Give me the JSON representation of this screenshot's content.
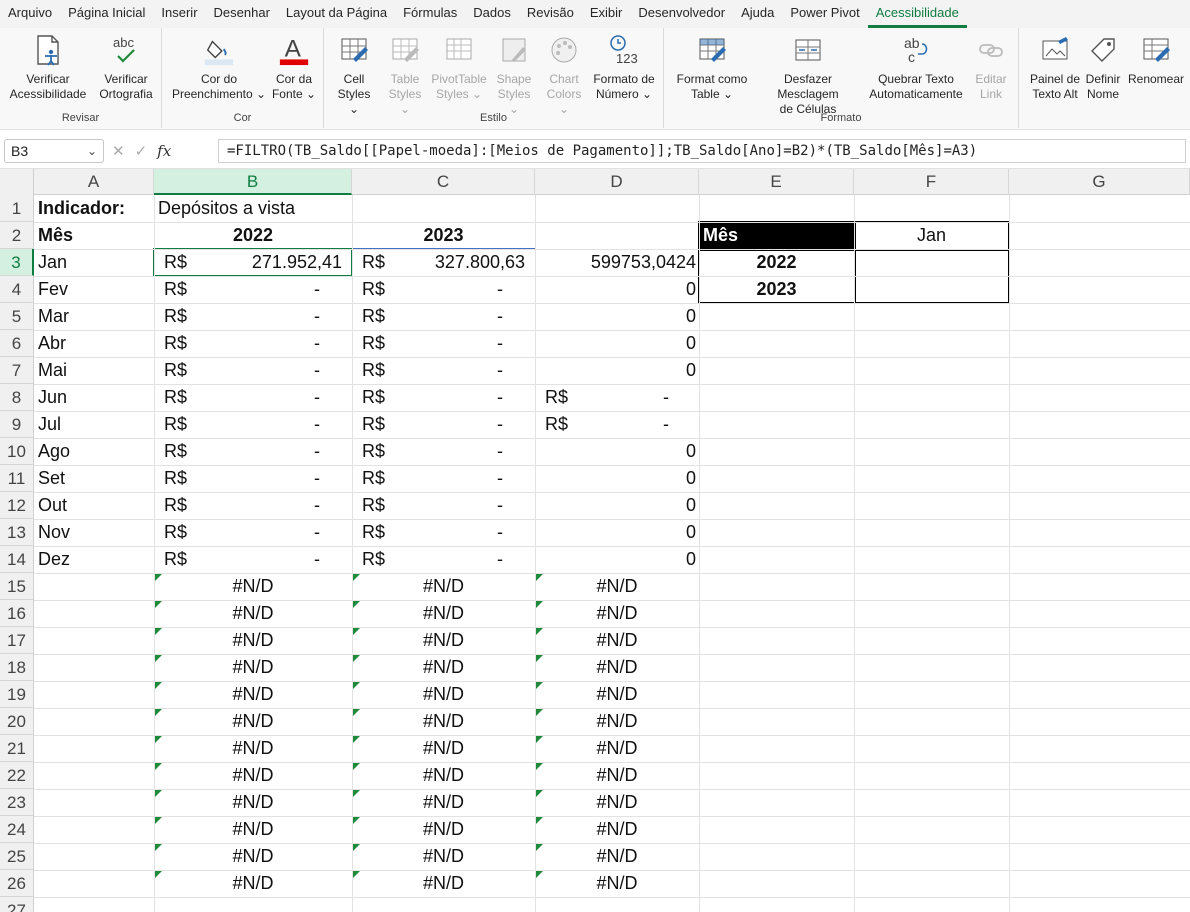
{
  "menu": {
    "tabs": [
      "Arquivo",
      "Página Inicial",
      "Inserir",
      "Desenhar",
      "Layout da Página",
      "Fórmulas",
      "Dados",
      "Revisão",
      "Exibir",
      "Desenvolvedor",
      "Ajuda",
      "Power Pivot",
      "Acessibilidade"
    ],
    "active_tab": "Acessibilidade"
  },
  "ribbon": {
    "groups": {
      "revisar": "Revisar",
      "cor": "Cor",
      "estilo": "Estilo",
      "formato": "Formato"
    },
    "buttons": {
      "verificar_acessibilidade": "Verificar\nAcessibilidade",
      "verificar_ortografia": "Verificar\nOrtografia",
      "cor_preenchimento": "Cor do\nPreenchimento ⌄",
      "cor_fonte": "Cor da\nFonte ⌄",
      "cell_styles": "Cell\nStyles ⌄",
      "table_styles": "Table\nStyles ⌄",
      "pivottable_styles": "PivotTable\nStyles ⌄",
      "shape_styles": "Shape\nStyles ⌄",
      "chart_colors": "Chart\nColors ⌄",
      "formato_numero": "Formato de\nNúmero ⌄",
      "format_como_table": "Format como\nTable ⌄",
      "desfazer_mesclagem": "Desfazer Mesclagem\nde Células",
      "quebrar_texto": "Quebrar Texto\nAutomaticamente",
      "editar_link": "Editar\nLink",
      "painel_texto_alt": "Painel de\nTexto Alt",
      "definir_nome": "Definir\nNome",
      "renomear": "Renomear"
    },
    "icon_text": {
      "abc": "abc",
      "ab": "ab",
      "c": "c",
      "num": "123",
      "letter_a": "A"
    }
  },
  "formula_bar": {
    "name_box": "B3",
    "name_box_caret": "⌄",
    "cancel": "✕",
    "enter": "✓",
    "fx": "fx",
    "formula": "=FILTRO(TB_Saldo[[Papel-moeda]:[Meios de Pagamento]];TB_Saldo[Ano]=B2)*(TB_Saldo[Mês]=A3)"
  },
  "columns": [
    "A",
    "B",
    "C",
    "D",
    "E",
    "F",
    "G"
  ],
  "rows": [
    "1",
    "2",
    "3",
    "4",
    "5",
    "6",
    "7",
    "8",
    "9",
    "10",
    "11",
    "12",
    "13",
    "14",
    "15",
    "16",
    "17",
    "18",
    "19",
    "20",
    "21",
    "22",
    "23",
    "24",
    "25",
    "26",
    "27"
  ],
  "sheet": {
    "a1": "Indicador:",
    "b1": "Depósitos a vista",
    "a2": "Mês",
    "b2": "2022",
    "c2": "2023",
    "months": [
      "Jan",
      "Fev",
      "Mar",
      "Abr",
      "Mai",
      "Jun",
      "Jul",
      "Ago",
      "Set",
      "Out",
      "Nov",
      "Dez"
    ],
    "currency": "R$",
    "dash": "-",
    "b_values": [
      "271.952,41",
      "-",
      "-",
      "-",
      "-",
      "-",
      "-",
      "-",
      "-",
      "-",
      "-",
      "-"
    ],
    "c_values": [
      "327.800,63",
      "-",
      "-",
      "-",
      "-",
      "-",
      "-",
      "-",
      "-",
      "-",
      "-",
      "-"
    ],
    "d_values": [
      "599753,0424",
      "0",
      "0",
      "0",
      "0",
      "R$|-",
      "R$|-",
      "0",
      "0",
      "0",
      "0",
      "0"
    ],
    "na": "#N/D",
    "lookup": {
      "header_label": "Mês",
      "header_value": "Jan",
      "row1": "2022",
      "row2": "2023"
    }
  },
  "colors": {
    "accent": "#107c41",
    "selected_header": "#d3f0e0",
    "lookup_header_bg": "#000000",
    "table_border": "#4472c4",
    "error_triangle": "#1e8a3a"
  }
}
